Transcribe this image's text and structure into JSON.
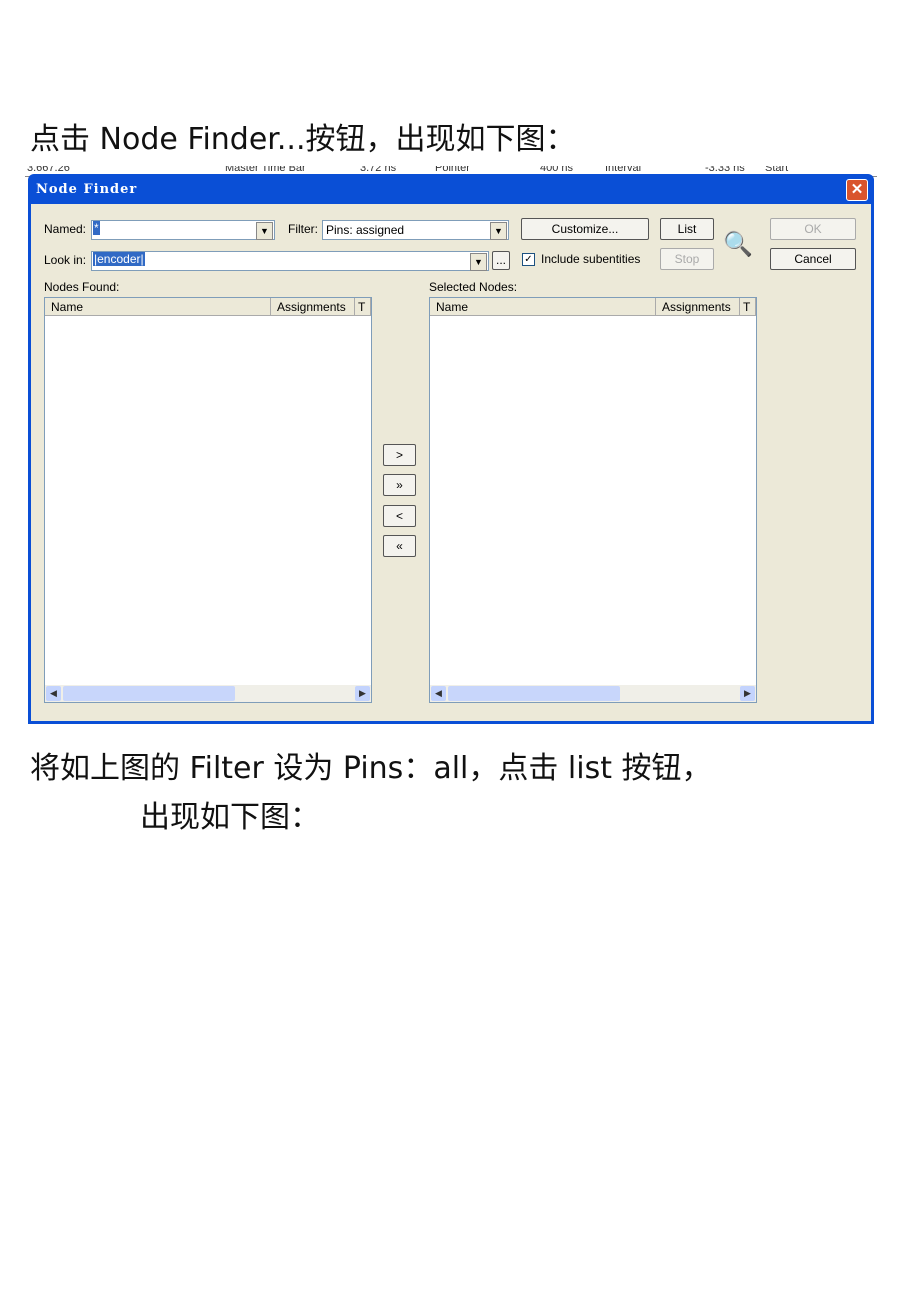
{
  "captions": {
    "top": "点击 Node Finder...按钮，出现如下图：",
    "bottom1": "将如上图的 Filter 设为 Pins：all，点击 list 按钮，",
    "bottom2": "出现如下图："
  },
  "background_strip": [
    "3.667.26",
    "Master Time Bar",
    "3.72 ns",
    "Pointer",
    "400 ns",
    "Interval",
    "-3.33 ns",
    "Start"
  ],
  "dialog": {
    "title": "Node Finder",
    "close": "✕",
    "named_label": "Named:",
    "named_value": "*",
    "filter_label": "Filter:",
    "filter_value": "Pins: assigned",
    "customize": "Customize...",
    "list": "List",
    "stop": "Stop",
    "ok": "OK",
    "cancel": "Cancel",
    "lookin_label": "Look in:",
    "lookin_value": "|encoder|",
    "browse": "...",
    "include_sub": "Include subentities",
    "include_checked": true,
    "nodes_found": "Nodes Found:",
    "selected_nodes": "Selected Nodes:",
    "columns": [
      "Name",
      "Assignments",
      "T"
    ],
    "move": [
      ">",
      "»",
      "<",
      "«"
    ]
  }
}
